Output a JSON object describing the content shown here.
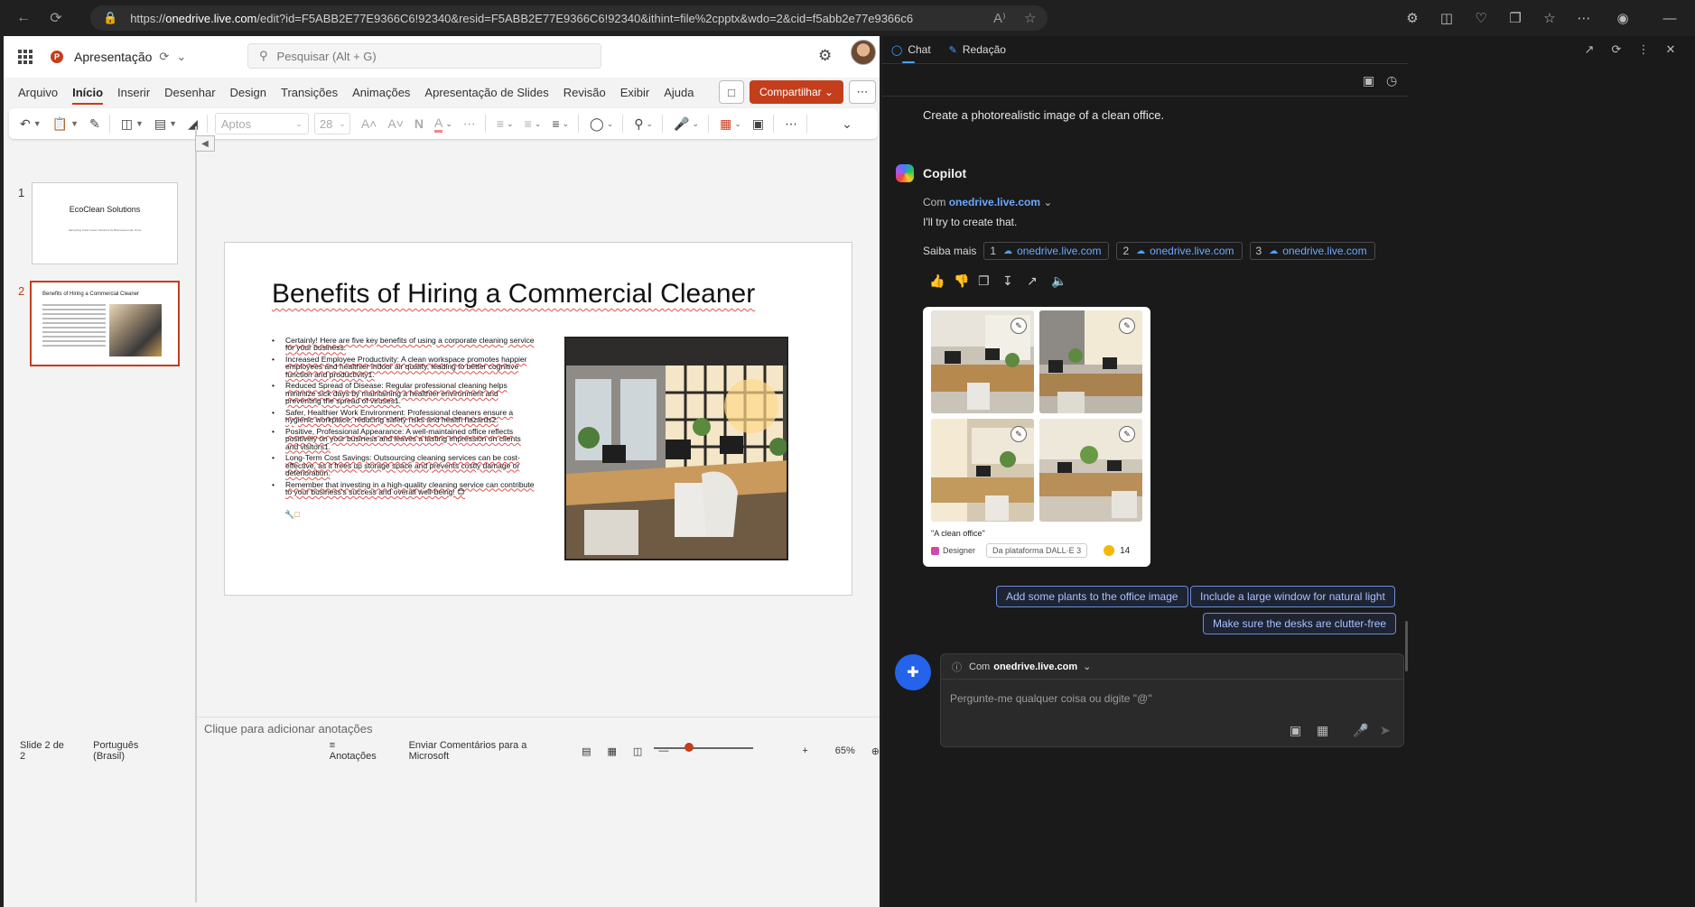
{
  "browser": {
    "url_prefix": "https://",
    "url_host": "onedrive.live.com",
    "url_rest": "/edit?id=F5ABB2E77E9366C6!92340&resid=F5ABB2E77E9366C6!92340&ithint=file%2cpptx&wdo=2&cid=f5abb2e77e9366c6"
  },
  "ppt": {
    "doc_title": "Apresentação",
    "search_placeholder": "Pesquisar (Alt + G)",
    "menu": [
      "Arquivo",
      "Início",
      "Inserir",
      "Desenhar",
      "Design",
      "Transições",
      "Animações",
      "Apresentação de Slides",
      "Revisão",
      "Exibir",
      "Ajuda"
    ],
    "active_menu": "Início",
    "share_label": "Compartilhar",
    "font_name": "Aptos",
    "font_size": "28",
    "slides": [
      {
        "num": "1",
        "title": "EcoClean Solutions",
        "subtitle": "Harvesting Clean Green Solutions for Businesses Like Yours"
      },
      {
        "num": "2",
        "title": "Benefits of Hiring a Commercial Cleaner"
      }
    ],
    "slide": {
      "title": "Benefits of Hiring a Commercial Cleaner",
      "bullets": [
        "Certainly! Here are five key benefits of using a corporate cleaning service for your business:",
        "Increased Employee Productivity: A clean workspace promotes happier employees and healthier indoor air quality, leading to better cognitive function and productivity1.",
        "Reduced Spread of Disease: Regular professional cleaning helps minimize sick days by maintaining a healthier environment and preventing the spread of viruses1.",
        "Safer, Healthier Work Environment: Professional cleaners ensure a hygienic workplace, reducing safety risks and health hazards2.",
        "Positive, Professional Appearance: A well-maintained office reflects positively on your business and leaves a lasting impression on clients and visitors1.",
        "Long-Term Cost Savings: Outsourcing cleaning services can be cost-effective, as it frees up storage space and prevents costly damage or deterioration.",
        "Remember that investing in a high-quality cleaning service can contribute to your business's success and overall well-being! 😊"
      ]
    },
    "notes_placeholder": "Clique para adicionar anotações",
    "status": {
      "slide_count": "Slide 2 de 2",
      "language": "Português (Brasil)",
      "notes_btn": "Anotações",
      "feedback": "Enviar Comentários para a Microsoft",
      "zoom": "65%"
    }
  },
  "copilot": {
    "tabs": [
      "Chat",
      "Redação"
    ],
    "user_message": "Create a photorealistic image of a clean office.",
    "assistant_name": "Copilot",
    "context_prefix": "Com",
    "context_host": "onedrive.live.com",
    "reply": "I'll try to create that.",
    "learn_more_label": "Saiba mais",
    "sources": [
      {
        "num": "1",
        "host": "onedrive.live.com"
      },
      {
        "num": "2",
        "host": "onedrive.live.com"
      },
      {
        "num": "3",
        "host": "onedrive.live.com"
      }
    ],
    "image_caption": "\"A clean office\"",
    "designer_label": "Designer",
    "platform_label": "Da plataforma DALL·E 3",
    "boost_count": "14",
    "suggestions": [
      "Add some plants to the office image",
      "Include a large window for natural light",
      "Make sure the desks are clutter-free"
    ],
    "input_context_prefix": "Com",
    "input_context_host": "onedrive.live.com",
    "input_placeholder": "Pergunte-me qualquer coisa ou digite \"@\""
  },
  "colors": {
    "ppt_accent": "#c43e1c",
    "copilot_bg": "#1a1a1a",
    "link_blue": "#6aa9ff"
  }
}
